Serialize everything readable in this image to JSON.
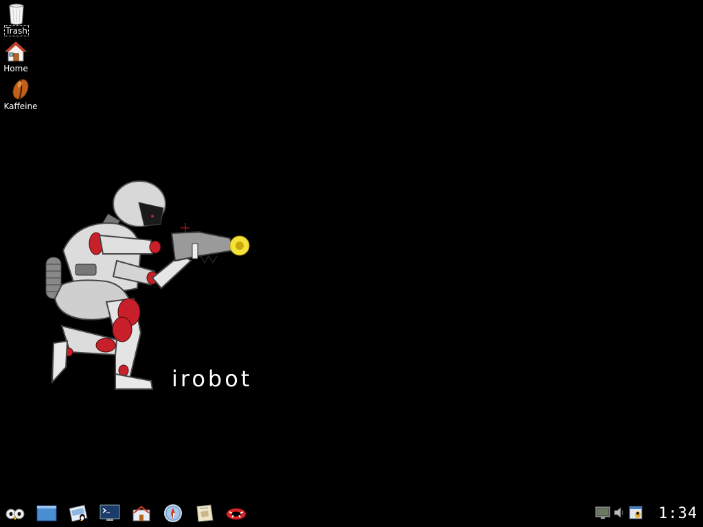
{
  "desktop": {
    "background_color": "#000000",
    "icons": [
      {
        "label": "Trash",
        "icon": "trash-icon"
      },
      {
        "label": "Home",
        "icon": "home-icon"
      },
      {
        "label": "Kaffeine",
        "icon": "kaffeine-icon"
      }
    ]
  },
  "wallpaper": {
    "text": "irobot",
    "accent_color": "#c8202a",
    "glow_color": "#f4e23a"
  },
  "taskbar": {
    "launchers": [
      {
        "icon": "k-menu-icon"
      },
      {
        "icon": "show-desktop-icon"
      },
      {
        "icon": "linux-window-icon"
      },
      {
        "icon": "terminal-icon"
      },
      {
        "icon": "home-folder-icon"
      },
      {
        "icon": "web-browser-icon"
      },
      {
        "icon": "notes-icon"
      },
      {
        "icon": "help-lifebuoy-icon"
      }
    ],
    "tray": [
      {
        "icon": "display-icon"
      },
      {
        "icon": "volume-icon"
      },
      {
        "icon": "klipper-icon"
      }
    ],
    "clock": "1:34"
  }
}
